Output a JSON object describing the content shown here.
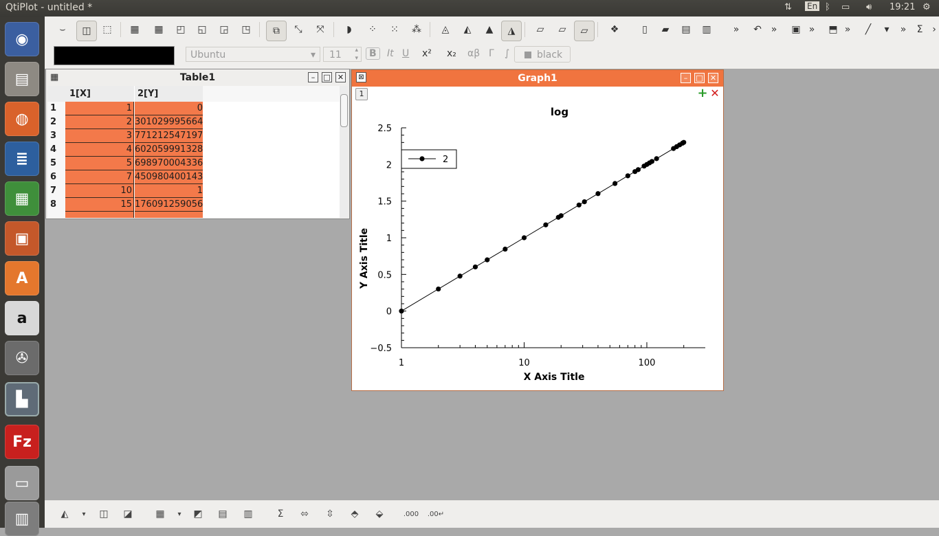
{
  "app": {
    "title": "QtiPlot - untitled *"
  },
  "indicators": {
    "keyboard": "En",
    "time": "19:21"
  },
  "format_bar": {
    "font": "Ubuntu",
    "size": "11",
    "bold": "B",
    "italic": "It",
    "underline": "U",
    "superscript": "x²",
    "subscript": "x₂",
    "greek": "αβ",
    "greek_upper": "Γ",
    "integral": "∫",
    "color_name": "black"
  },
  "table_window": {
    "title": "Table1",
    "columns": [
      "1[X]",
      "2[Y]"
    ],
    "rows": [
      {
        "n": "1",
        "x": "1",
        "y": "0"
      },
      {
        "n": "2",
        "x": "2",
        "y": "301029995664"
      },
      {
        "n": "3",
        "x": "3",
        "y": "771212547197"
      },
      {
        "n": "4",
        "x": "4",
        "y": "602059991328"
      },
      {
        "n": "5",
        "x": "5",
        "y": "698970004336"
      },
      {
        "n": "6",
        "x": "7",
        "y": "450980400143"
      },
      {
        "n": "7",
        "x": "10",
        "y": "1"
      },
      {
        "n": "8",
        "x": "15",
        "y": "176091259056"
      }
    ]
  },
  "graph_window": {
    "title": "Graph1",
    "layer_label": "1",
    "add_layer": "+",
    "remove_layer": "✕"
  },
  "chart_data": {
    "type": "scatter",
    "title": "log",
    "xlabel": "X Axis Title",
    "ylabel": "Y Axis Title",
    "xscale": "log",
    "xlim": [
      1,
      250
    ],
    "ylim": [
      -0.5,
      2.5
    ],
    "x_ticks": [
      "1",
      "10",
      "100"
    ],
    "y_ticks": [
      "−0.5",
      "0",
      "0.5",
      "1",
      "1.5",
      "2",
      "2.5"
    ],
    "legend": {
      "label": "2",
      "placement": "top-left"
    },
    "series": [
      {
        "name": "2",
        "style": "line+symbol",
        "color": "#000000",
        "x": [
          1,
          2,
          3,
          4,
          5,
          7,
          10,
          15,
          19,
          20,
          28,
          31,
          40,
          55,
          70,
          80,
          85,
          95,
          100,
          105,
          110,
          120,
          165,
          175,
          185,
          195,
          200
        ],
        "y": [
          0,
          0.30103,
          0.47712,
          0.60206,
          0.69897,
          0.8451,
          1,
          1.17609,
          1.27875,
          1.30103,
          1.44716,
          1.49136,
          1.60206,
          1.74036,
          1.8451,
          1.90309,
          1.92942,
          1.97772,
          2,
          2.02119,
          2.04139,
          2.07918,
          2.21748,
          2.24304,
          2.26717,
          2.29003,
          2.30103
        ]
      }
    ]
  }
}
